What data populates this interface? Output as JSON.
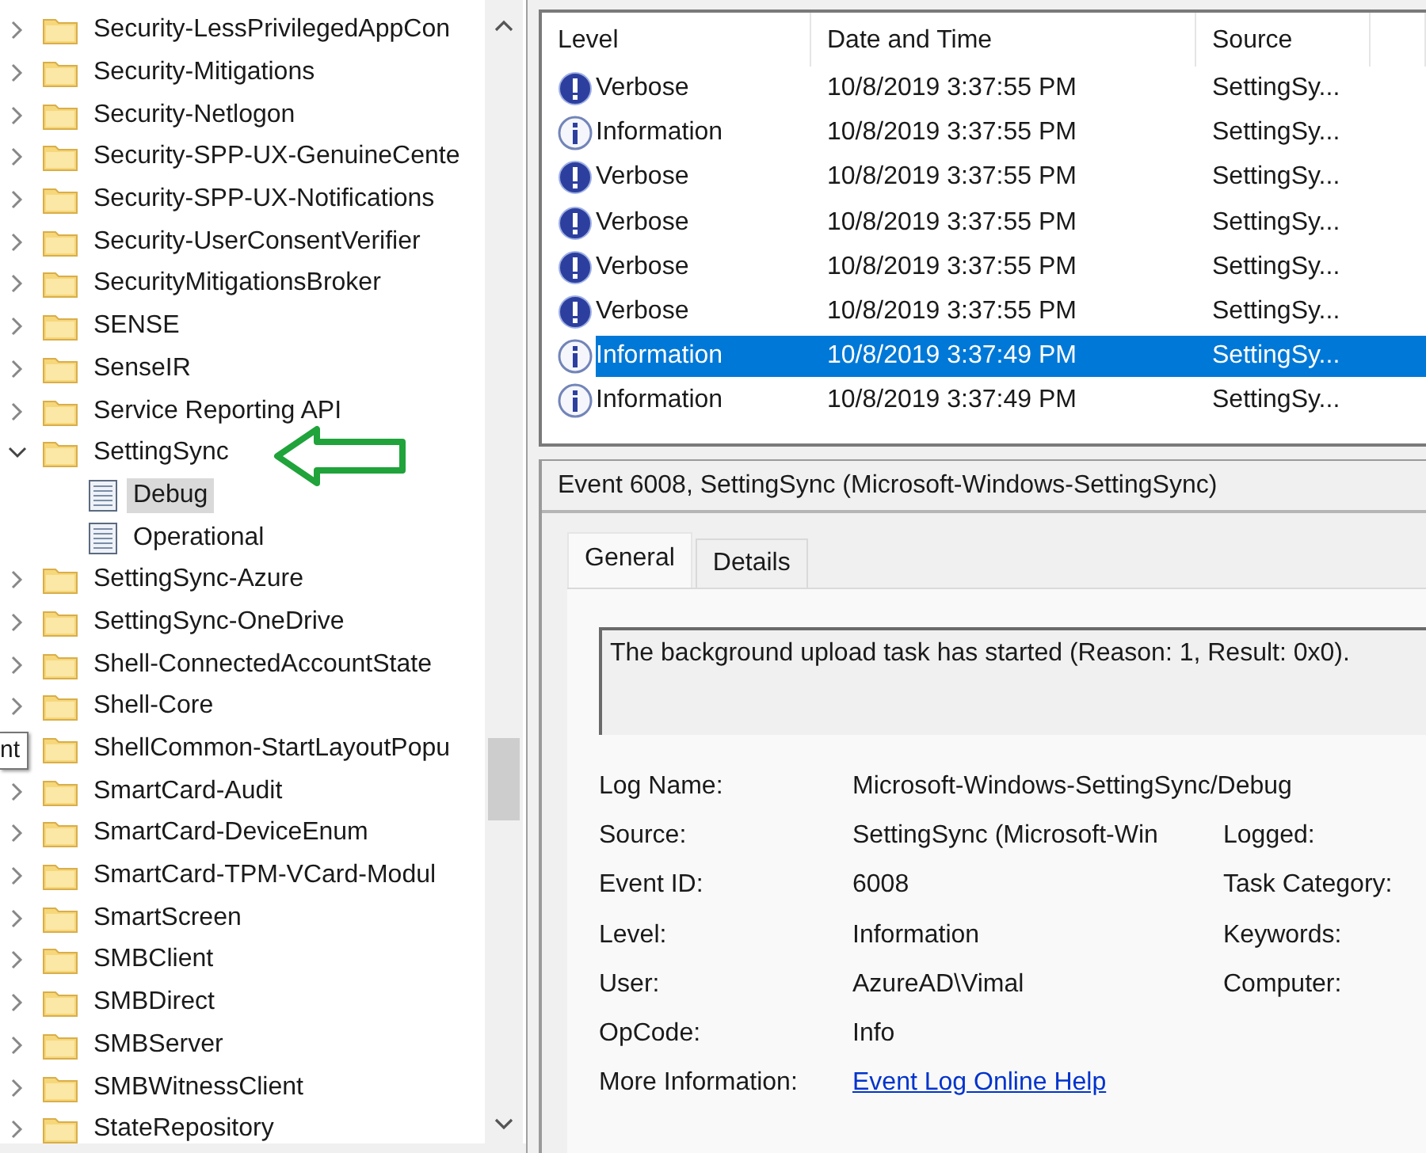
{
  "tree": {
    "items": [
      {
        "label": "Security-LessPrivilegedAppCon",
        "expanded": false,
        "selected": false
      },
      {
        "label": "Security-Mitigations",
        "expanded": false,
        "selected": false
      },
      {
        "label": "Security-Netlogon",
        "expanded": false,
        "selected": false
      },
      {
        "label": "Security-SPP-UX-GenuineCente",
        "expanded": false,
        "selected": false
      },
      {
        "label": "Security-SPP-UX-Notifications",
        "expanded": false,
        "selected": false
      },
      {
        "label": "Security-UserConsentVerifier",
        "expanded": false,
        "selected": false
      },
      {
        "label": "SecurityMitigationsBroker",
        "expanded": false,
        "selected": false
      },
      {
        "label": "SENSE",
        "expanded": false,
        "selected": false
      },
      {
        "label": "SenseIR",
        "expanded": false,
        "selected": false
      },
      {
        "label": "Service Reporting API",
        "expanded": false,
        "selected": false
      },
      {
        "label": "SettingSync",
        "expanded": true,
        "selected": false,
        "children": [
          {
            "label": "Debug",
            "selected": true
          },
          {
            "label": "Operational",
            "selected": false
          }
        ]
      },
      {
        "label": "SettingSync-Azure",
        "expanded": false,
        "selected": false
      },
      {
        "label": "SettingSync-OneDrive",
        "expanded": false,
        "selected": false
      },
      {
        "label": "Shell-ConnectedAccountState",
        "expanded": false,
        "selected": false
      },
      {
        "label": "Shell-Core",
        "expanded": false,
        "selected": false
      },
      {
        "label": "ShellCommon-StartLayoutPopu",
        "selected": false
      },
      {
        "label": "SmartCard-Audit",
        "expanded": false,
        "selected": false
      },
      {
        "label": "SmartCard-DeviceEnum",
        "expanded": false,
        "selected": false
      },
      {
        "label": "SmartCard-TPM-VCard-Modul",
        "expanded": false,
        "selected": false
      },
      {
        "label": "SmartScreen",
        "expanded": false,
        "selected": false
      },
      {
        "label": "SMBClient",
        "expanded": false,
        "selected": false
      },
      {
        "label": "SMBDirect",
        "expanded": false,
        "selected": false
      },
      {
        "label": "SMBServer",
        "expanded": false,
        "selected": false
      },
      {
        "label": "SMBWitnessClient",
        "expanded": false,
        "selected": false
      },
      {
        "label": "StateRepository",
        "expanded": false,
        "selected": false
      }
    ],
    "tooltip": "nt"
  },
  "events": {
    "columns": [
      "Level",
      "Date and Time",
      "Source"
    ],
    "rows": [
      {
        "kind": "verbose",
        "level": "Verbose",
        "date": "10/8/2019 3:37:55 PM",
        "source": "SettingSy...",
        "selected": false
      },
      {
        "kind": "information",
        "level": "Information",
        "date": "10/8/2019 3:37:55 PM",
        "source": "SettingSy...",
        "selected": false
      },
      {
        "kind": "verbose",
        "level": "Verbose",
        "date": "10/8/2019 3:37:55 PM",
        "source": "SettingSy...",
        "selected": false
      },
      {
        "kind": "verbose",
        "level": "Verbose",
        "date": "10/8/2019 3:37:55 PM",
        "source": "SettingSy...",
        "selected": false
      },
      {
        "kind": "verbose",
        "level": "Verbose",
        "date": "10/8/2019 3:37:55 PM",
        "source": "SettingSy...",
        "selected": false
      },
      {
        "kind": "verbose",
        "level": "Verbose",
        "date": "10/8/2019 3:37:55 PM",
        "source": "SettingSy...",
        "selected": false
      },
      {
        "kind": "information",
        "level": "Information",
        "date": "10/8/2019 3:37:49 PM",
        "source": "SettingSy...",
        "selected": true
      },
      {
        "kind": "information",
        "level": "Information",
        "date": "10/8/2019 3:37:49 PM",
        "source": "SettingSy...",
        "selected": false
      }
    ]
  },
  "details": {
    "title": "Event 6008, SettingSync (Microsoft-Windows-SettingSync)",
    "tabs": [
      {
        "label": "General",
        "selected": true
      },
      {
        "label": "Details",
        "selected": false
      }
    ],
    "message": "The background upload task has started (Reason: 1, Result: 0x0).",
    "fields": [
      {
        "label": "Log Name:",
        "value": "Microsoft-Windows-SettingSync/Debug"
      },
      {
        "label": "Source:",
        "value": "SettingSync (Microsoft-Win",
        "label_2": "Logged:"
      },
      {
        "label": "Event ID:",
        "value": "6008",
        "label_2": "Task Category:"
      },
      {
        "label": "Level:",
        "value": "Information",
        "label_2": "Keywords:"
      },
      {
        "label": "User:",
        "value": "AzureAD\\Vimal",
        "label_2": "Computer:"
      },
      {
        "label": "OpCode:",
        "value": "Info"
      },
      {
        "label": "More Information:",
        "link": "Event Log Online Help"
      }
    ]
  }
}
